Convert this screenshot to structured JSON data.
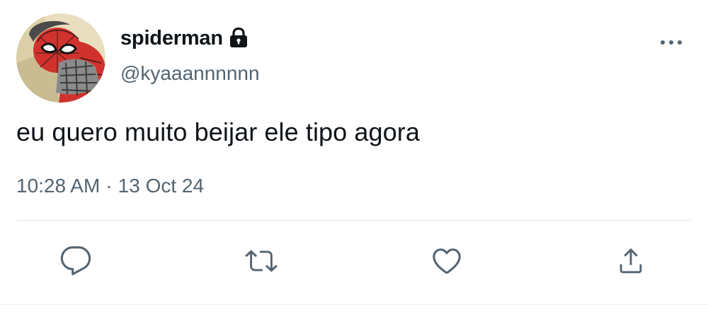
{
  "author": {
    "display_name": "spiderman",
    "handle": "@kyaaannnnnn",
    "avatar_icon": "spiderman-avatar-icon",
    "protected_icon": "lock-icon"
  },
  "tweet": {
    "text": "eu quero muito beijar ele tipo agora",
    "time": "10:28 AM",
    "separator": "·",
    "date": "13 Oct 24"
  },
  "actions": [
    {
      "name": "reply",
      "icon": "speech-bubble-icon"
    },
    {
      "name": "retweet",
      "icon": "retweet-arrows-icon"
    },
    {
      "name": "like",
      "icon": "heart-icon"
    },
    {
      "name": "share",
      "icon": "share-upload-icon"
    }
  ],
  "more_icon": "ellipsis-icon",
  "colors": {
    "text_primary": "#0f1419",
    "text_secondary": "#536471",
    "icon": "#536471",
    "divider": "#e3e7eb"
  }
}
